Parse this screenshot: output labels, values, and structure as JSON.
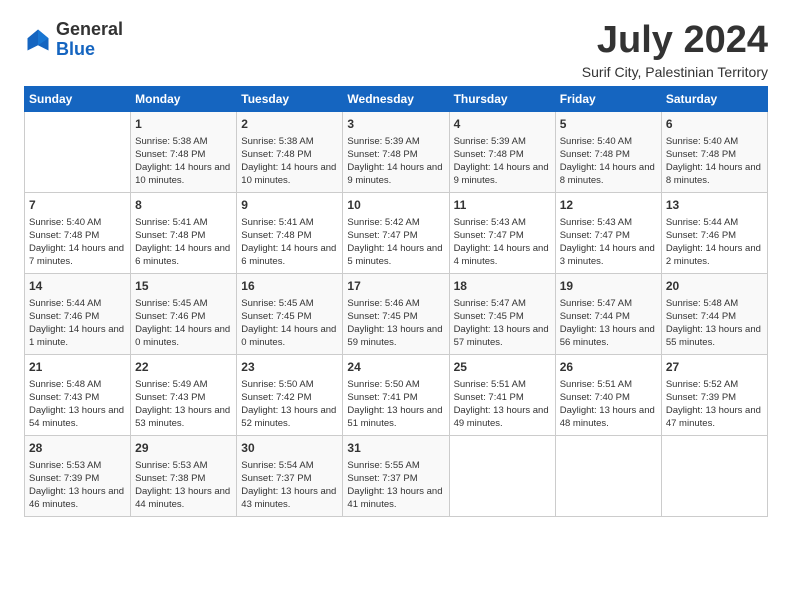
{
  "logo": {
    "general": "General",
    "blue": "Blue"
  },
  "title": "July 2024",
  "location": "Surif City, Palestinian Territory",
  "days_of_week": [
    "Sunday",
    "Monday",
    "Tuesday",
    "Wednesday",
    "Thursday",
    "Friday",
    "Saturday"
  ],
  "weeks": [
    [
      {
        "num": "",
        "sunrise": "",
        "sunset": "",
        "daylight": "",
        "empty": true
      },
      {
        "num": "1",
        "sunrise": "Sunrise: 5:38 AM",
        "sunset": "Sunset: 7:48 PM",
        "daylight": "Daylight: 14 hours and 10 minutes."
      },
      {
        "num": "2",
        "sunrise": "Sunrise: 5:38 AM",
        "sunset": "Sunset: 7:48 PM",
        "daylight": "Daylight: 14 hours and 10 minutes."
      },
      {
        "num": "3",
        "sunrise": "Sunrise: 5:39 AM",
        "sunset": "Sunset: 7:48 PM",
        "daylight": "Daylight: 14 hours and 9 minutes."
      },
      {
        "num": "4",
        "sunrise": "Sunrise: 5:39 AM",
        "sunset": "Sunset: 7:48 PM",
        "daylight": "Daylight: 14 hours and 9 minutes."
      },
      {
        "num": "5",
        "sunrise": "Sunrise: 5:40 AM",
        "sunset": "Sunset: 7:48 PM",
        "daylight": "Daylight: 14 hours and 8 minutes."
      },
      {
        "num": "6",
        "sunrise": "Sunrise: 5:40 AM",
        "sunset": "Sunset: 7:48 PM",
        "daylight": "Daylight: 14 hours and 8 minutes."
      }
    ],
    [
      {
        "num": "7",
        "sunrise": "Sunrise: 5:40 AM",
        "sunset": "Sunset: 7:48 PM",
        "daylight": "Daylight: 14 hours and 7 minutes."
      },
      {
        "num": "8",
        "sunrise": "Sunrise: 5:41 AM",
        "sunset": "Sunset: 7:48 PM",
        "daylight": "Daylight: 14 hours and 6 minutes."
      },
      {
        "num": "9",
        "sunrise": "Sunrise: 5:41 AM",
        "sunset": "Sunset: 7:48 PM",
        "daylight": "Daylight: 14 hours and 6 minutes."
      },
      {
        "num": "10",
        "sunrise": "Sunrise: 5:42 AM",
        "sunset": "Sunset: 7:47 PM",
        "daylight": "Daylight: 14 hours and 5 minutes."
      },
      {
        "num": "11",
        "sunrise": "Sunrise: 5:43 AM",
        "sunset": "Sunset: 7:47 PM",
        "daylight": "Daylight: 14 hours and 4 minutes."
      },
      {
        "num": "12",
        "sunrise": "Sunrise: 5:43 AM",
        "sunset": "Sunset: 7:47 PM",
        "daylight": "Daylight: 14 hours and 3 minutes."
      },
      {
        "num": "13",
        "sunrise": "Sunrise: 5:44 AM",
        "sunset": "Sunset: 7:46 PM",
        "daylight": "Daylight: 14 hours and 2 minutes."
      }
    ],
    [
      {
        "num": "14",
        "sunrise": "Sunrise: 5:44 AM",
        "sunset": "Sunset: 7:46 PM",
        "daylight": "Daylight: 14 hours and 1 minute."
      },
      {
        "num": "15",
        "sunrise": "Sunrise: 5:45 AM",
        "sunset": "Sunset: 7:46 PM",
        "daylight": "Daylight: 14 hours and 0 minutes."
      },
      {
        "num": "16",
        "sunrise": "Sunrise: 5:45 AM",
        "sunset": "Sunset: 7:45 PM",
        "daylight": "Daylight: 14 hours and 0 minutes."
      },
      {
        "num": "17",
        "sunrise": "Sunrise: 5:46 AM",
        "sunset": "Sunset: 7:45 PM",
        "daylight": "Daylight: 13 hours and 59 minutes."
      },
      {
        "num": "18",
        "sunrise": "Sunrise: 5:47 AM",
        "sunset": "Sunset: 7:45 PM",
        "daylight": "Daylight: 13 hours and 57 minutes."
      },
      {
        "num": "19",
        "sunrise": "Sunrise: 5:47 AM",
        "sunset": "Sunset: 7:44 PM",
        "daylight": "Daylight: 13 hours and 56 minutes."
      },
      {
        "num": "20",
        "sunrise": "Sunrise: 5:48 AM",
        "sunset": "Sunset: 7:44 PM",
        "daylight": "Daylight: 13 hours and 55 minutes."
      }
    ],
    [
      {
        "num": "21",
        "sunrise": "Sunrise: 5:48 AM",
        "sunset": "Sunset: 7:43 PM",
        "daylight": "Daylight: 13 hours and 54 minutes."
      },
      {
        "num": "22",
        "sunrise": "Sunrise: 5:49 AM",
        "sunset": "Sunset: 7:43 PM",
        "daylight": "Daylight: 13 hours and 53 minutes."
      },
      {
        "num": "23",
        "sunrise": "Sunrise: 5:50 AM",
        "sunset": "Sunset: 7:42 PM",
        "daylight": "Daylight: 13 hours and 52 minutes."
      },
      {
        "num": "24",
        "sunrise": "Sunrise: 5:50 AM",
        "sunset": "Sunset: 7:41 PM",
        "daylight": "Daylight: 13 hours and 51 minutes."
      },
      {
        "num": "25",
        "sunrise": "Sunrise: 5:51 AM",
        "sunset": "Sunset: 7:41 PM",
        "daylight": "Daylight: 13 hours and 49 minutes."
      },
      {
        "num": "26",
        "sunrise": "Sunrise: 5:51 AM",
        "sunset": "Sunset: 7:40 PM",
        "daylight": "Daylight: 13 hours and 48 minutes."
      },
      {
        "num": "27",
        "sunrise": "Sunrise: 5:52 AM",
        "sunset": "Sunset: 7:39 PM",
        "daylight": "Daylight: 13 hours and 47 minutes."
      }
    ],
    [
      {
        "num": "28",
        "sunrise": "Sunrise: 5:53 AM",
        "sunset": "Sunset: 7:39 PM",
        "daylight": "Daylight: 13 hours and 46 minutes."
      },
      {
        "num": "29",
        "sunrise": "Sunrise: 5:53 AM",
        "sunset": "Sunset: 7:38 PM",
        "daylight": "Daylight: 13 hours and 44 minutes."
      },
      {
        "num": "30",
        "sunrise": "Sunrise: 5:54 AM",
        "sunset": "Sunset: 7:37 PM",
        "daylight": "Daylight: 13 hours and 43 minutes."
      },
      {
        "num": "31",
        "sunrise": "Sunrise: 5:55 AM",
        "sunset": "Sunset: 7:37 PM",
        "daylight": "Daylight: 13 hours and 41 minutes."
      },
      {
        "num": "",
        "sunrise": "",
        "sunset": "",
        "daylight": "",
        "empty": true
      },
      {
        "num": "",
        "sunrise": "",
        "sunset": "",
        "daylight": "",
        "empty": true
      },
      {
        "num": "",
        "sunrise": "",
        "sunset": "",
        "daylight": "",
        "empty": true
      }
    ]
  ]
}
